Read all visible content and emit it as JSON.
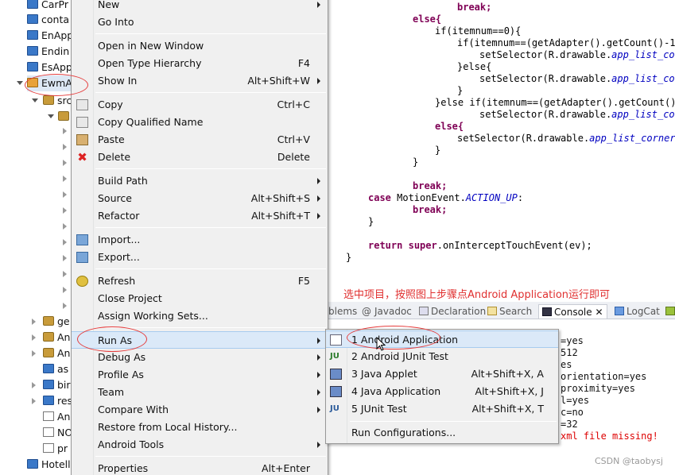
{
  "tree": {
    "items": [
      {
        "label": "CarPr",
        "icon": "folder-icon"
      },
      {
        "label": "conta",
        "icon": "folder-icon"
      },
      {
        "label": "EnApp",
        "icon": "folder-icon"
      },
      {
        "label": "Endin",
        "icon": "folder-icon"
      },
      {
        "label": "EsApp",
        "icon": "folder-icon"
      },
      {
        "label": "EwmA",
        "icon": "android-project-icon"
      },
      {
        "label": "src",
        "icon": "package-folder-icon"
      },
      {
        "label": "ge",
        "icon": "package-folder-icon"
      },
      {
        "label": "An",
        "icon": "library-icon"
      },
      {
        "label": "An",
        "icon": "library-icon"
      },
      {
        "label": "as",
        "icon": "folder-icon"
      },
      {
        "label": "bir",
        "icon": "folder-icon"
      },
      {
        "label": "res",
        "icon": "folder-icon"
      },
      {
        "label": "An",
        "icon": "file-icon"
      },
      {
        "label": "NO",
        "icon": "file-icon"
      },
      {
        "label": "pr",
        "icon": "file-icon"
      },
      {
        "label": "Hotell",
        "icon": "folder-icon"
      }
    ]
  },
  "code": {
    "l0": "break;",
    "l1": "else{",
    "l2": "if(itemnum==0){",
    "l3": "if(itemnum==(getAdapter().getCount()-1)",
    "l4a": "setSelector(R.drawable.",
    "l4b": "app_list_cor",
    "l5": "}else{",
    "l6a": "setSelector(R.drawable.",
    "l6b": "app_list_cor",
    "l7": "}",
    "l8": "}else if(itemnum==(getAdapter().getCount()-",
    "l9a": "setSelector(R.drawable.",
    "l9b": "app_list_cor",
    "l10": "else{",
    "l11a": "setSelector(R.drawable.",
    "l11b": "app_list_corner_",
    "l12": "}",
    "l13": "}",
    "l14": "break;",
    "l15a": "case",
    "l15b": " MotionEvent.",
    "l15c": "ACTION_UP",
    "l15d": ":",
    "l16": "break;",
    "l17": "}",
    "l18a": "return",
    "l18b": " ",
    "l18c": "super",
    "l18d": ".onInterceptTouchEvent(ev);",
    "l19": "}"
  },
  "annotation": "选中项目，按照图上步骤点Android Application运行即可",
  "tabs": {
    "problems": "blems",
    "javadoc": "Javadoc",
    "declaration": "Declaration",
    "search": "Search",
    "console": "Console",
    "console_close": "✕",
    "logcat": "LogCat"
  },
  "console_lines": [
    "=yes",
    "512",
    "es",
    "orientation=yes",
    "proximity=yes",
    "l=yes",
    "c=no",
    "=32",
    "xml file missing!"
  ],
  "context_menu": {
    "new": "New",
    "go_into": "Go Into",
    "open_new_window": "Open in New Window",
    "open_type_hierarchy": "Open Type Hierarchy",
    "open_type_hierarchy_sc": "F4",
    "show_in": "Show In",
    "show_in_sc": "Alt+Shift+W",
    "copy": "Copy",
    "copy_sc": "Ctrl+C",
    "copy_qualified": "Copy Qualified Name",
    "paste": "Paste",
    "paste_sc": "Ctrl+V",
    "delete": "Delete",
    "delete_sc": "Delete",
    "build_path": "Build Path",
    "source": "Source",
    "source_sc": "Alt+Shift+S",
    "refactor": "Refactor",
    "refactor_sc": "Alt+Shift+T",
    "import": "Import...",
    "export": "Export...",
    "refresh": "Refresh",
    "refresh_sc": "F5",
    "close_project": "Close Project",
    "assign_working_sets": "Assign Working Sets...",
    "run_as": "Run As",
    "debug_as": "Debug As",
    "profile_as": "Profile As",
    "team": "Team",
    "compare_with": "Compare With",
    "restore_history": "Restore from Local History...",
    "android_tools": "Android Tools",
    "properties": "Properties",
    "properties_sc": "Alt+Enter"
  },
  "run_as_menu": {
    "android_app": "1 Android Application",
    "android_junit": "2 Android JUnit Test",
    "java_applet": "3 Java Applet",
    "java_applet_sc": "Alt+Shift+X, A",
    "java_app": "4 Java Application",
    "java_app_sc": "Alt+Shift+X, J",
    "junit": "5 JUnit Test",
    "junit_sc": "Alt+Shift+X, T",
    "run_configs": "Run Configurations..."
  },
  "watermark": "CSDN @taobysj",
  "colors": {
    "annotation": "#e03030",
    "highlight": "#dbe9f8",
    "keyword": "#7f0055",
    "field": "#0000c0",
    "error": "#d00000"
  }
}
